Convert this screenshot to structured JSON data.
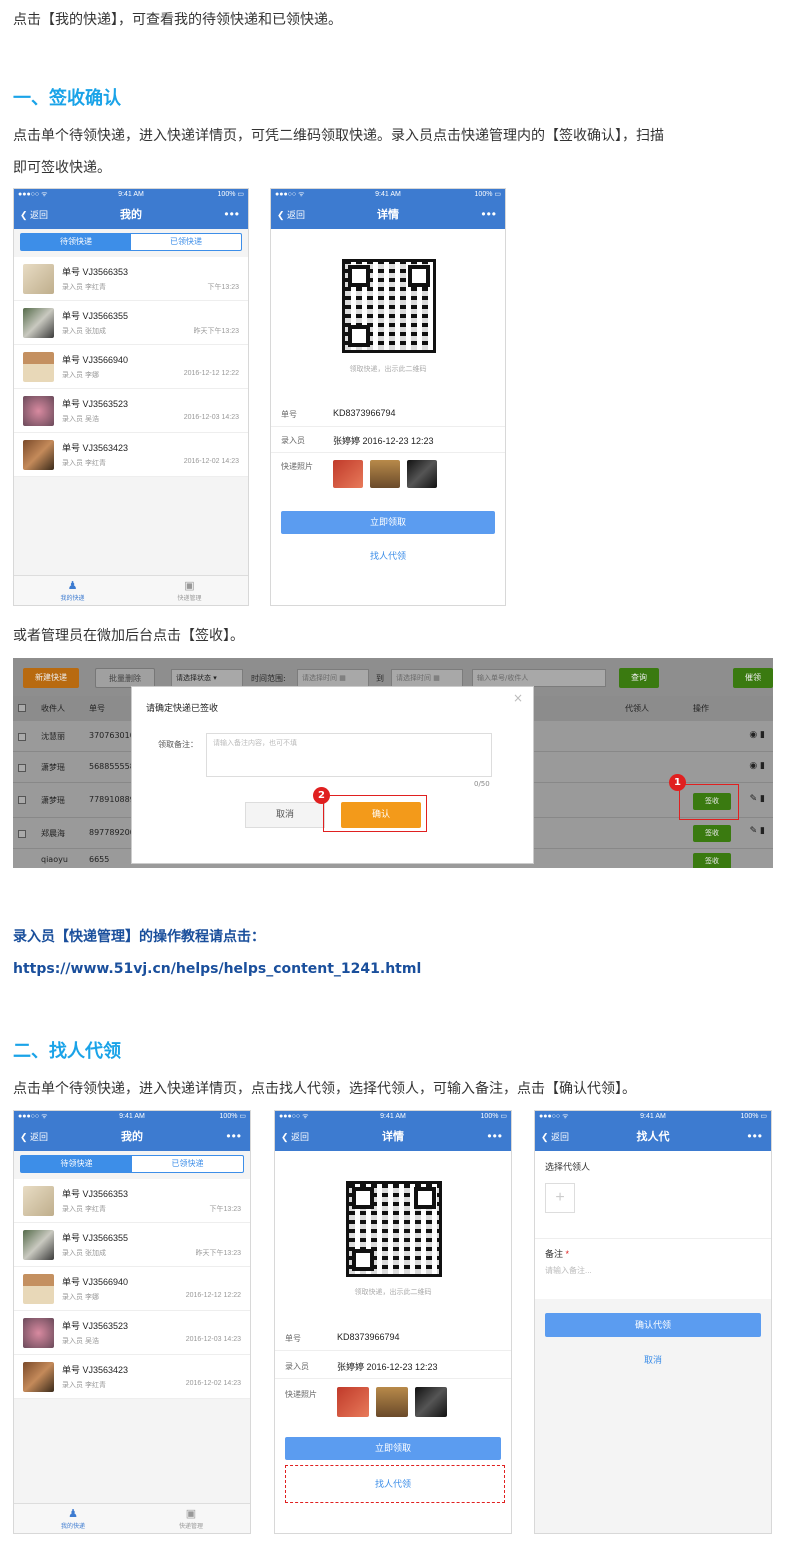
{
  "intro": "点击【我的快递】，可查看我的待领快递和已领快递。",
  "section1": {
    "title": "一、签收确认",
    "desc_line1": "点击单个待领快递，进入快递详情页，可凭二维码领取快递。录入员点击快递管理内的【签收确认】，扫描",
    "desc_line2": "即可签收快递。"
  },
  "phone_common": {
    "status_left": "●●●○○ ᯤ",
    "time": "9:41 AM",
    "battery": "100% ▭",
    "back": "❮ 返回",
    "more": "•••"
  },
  "my_page": {
    "title": "我的",
    "seg_pending": "待领快递",
    "seg_received": "已领快递",
    "items": [
      {
        "no": "单号  VJ3566353",
        "recorder": "录入员  李红青",
        "time": "下午13:23"
      },
      {
        "no": "单号  VJ3566355",
        "recorder": "录入员  张加成",
        "time": "昨天下午13:23"
      },
      {
        "no": "单号  VJ3566940",
        "recorder": "录入员  李娜",
        "time": "2016-12-12 12:22"
      },
      {
        "no": "单号  VJ3563523",
        "recorder": "录入员  吴浩",
        "time": "2016-12-03 14:23"
      },
      {
        "no": "单号  VJ3563423",
        "recorder": "录入员  李红青",
        "time": "2016-12-02 14:23"
      }
    ],
    "tab_my": "我的快递",
    "tab_manage": "快递管理"
  },
  "detail_page": {
    "title": "详情",
    "qr_caption": "领取快递，出示此二维码",
    "no_label": "单号",
    "no_value": "KD8373966794",
    "rec_label": "录入员",
    "rec_value": "张婷婷  2016-12-23 12:23",
    "photo_label": "快递照片",
    "claim_button": "立即领取",
    "proxy_link": "找人代领"
  },
  "admin_intro": "或者管理员在微加后台点击【签收】。",
  "admin": {
    "new_btn": "新建快递",
    "batch_delete": "批量删除",
    "status_select": "请选择状态",
    "time_range": "时间范围:",
    "start_placeholder": "请选择时间",
    "to": "到",
    "end_placeholder": "请选择时间",
    "search_placeholder": "输入单号/收件人",
    "query_btn": "查询",
    "remind_btn": "催领",
    "col_receiver": "收件人",
    "col_no": "单号",
    "col_proxy": "代领人",
    "col_action": "操作",
    "rows": [
      {
        "name": "沈慧丽",
        "no": "370763010"
      },
      {
        "name": "潇梦瑶",
        "no": "568855558"
      },
      {
        "name": "潇梦瑶",
        "no": "778910889"
      },
      {
        "name": "郑晨海",
        "no": "897789200"
      },
      {
        "name": "qiaoyu",
        "no": "6655"
      }
    ],
    "sign_btn": "签收",
    "modal_title": "请确定快递已签收",
    "remark_label": "领取备注：",
    "remark_placeholder": "请输入备注内容，也可不填",
    "counter": "0/50",
    "cancel": "取消",
    "confirm": "确认",
    "marker1": "1",
    "marker2": "2"
  },
  "tutorial_label": "录入员【快递管理】的操作教程请点击：",
  "tutorial_url": "https://www.51vj.cn/helps/helps_content_1241.html",
  "section2": {
    "title": "二、找人代领",
    "desc": "点击单个待领快递，进入快递详情页，点击找人代领，选择代领人，可输入备注，点击【确认代领】。"
  },
  "proxy_page": {
    "title": "找人代",
    "select_label": "选择代领人",
    "add": "+",
    "remark_label": "备注",
    "required": "*",
    "remark_placeholder": "请输入备注...",
    "confirm_button": "确认代领",
    "cancel": "取消"
  }
}
